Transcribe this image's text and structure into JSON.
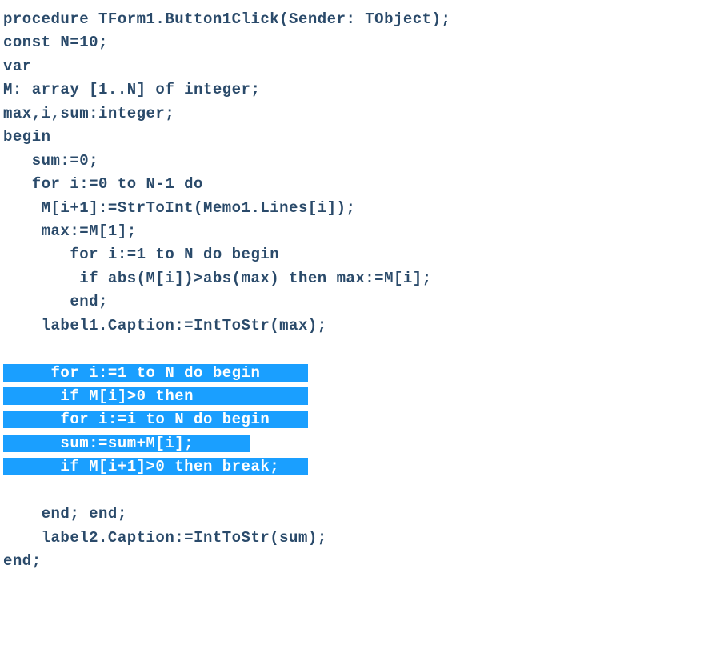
{
  "code": {
    "l1": "procedure TForm1.Button1Click(Sender: TObject);",
    "l2": "const N=10;",
    "l3": "var",
    "l4": "M: array [1..N] of integer;",
    "l5": "max,i,sum:integer;",
    "l6": "begin",
    "l7": "   sum:=0;",
    "l8": "   for i:=0 to N-1 do",
    "l9": "    M[i+1]:=StrToInt(Memo1.Lines[i]);",
    "l10": "    max:=M[1];",
    "l11": "       for i:=1 to N do begin",
    "l12": "        if abs(M[i])>abs(max) then max:=M[i];",
    "l13": "       end;",
    "l14": "    label1.Caption:=IntToStr(max);",
    "sel1": "     for i:=1 to N do begin     ",
    "sel2": "      if M[i]>0 then            ",
    "sel3": "      for i:=i to N do begin    ",
    "sel4": "      sum:=sum+M[i];      ",
    "sel5": "      if M[i+1]>0 then break;   ",
    "l20": "    end; end;",
    "l21": "    label2.Caption:=IntToStr(sum);",
    "l22": "end;"
  }
}
